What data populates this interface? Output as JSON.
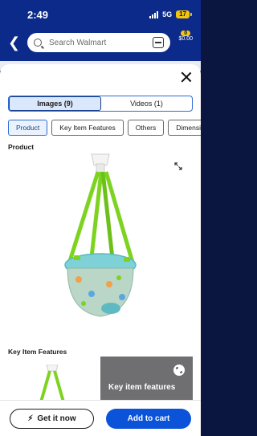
{
  "status": {
    "time": "2:49",
    "network": "5G",
    "battery": "17"
  },
  "background_header": {
    "search_placeholder": "Search Walmart",
    "cart_count": "0",
    "cart_total": "$0.00",
    "strip_text": "--"
  },
  "modal": {
    "media_tabs": [
      {
        "label": "Images (9)",
        "active": true
      },
      {
        "label": "Videos (1)",
        "active": false
      }
    ],
    "category_chips": [
      {
        "label": "Product",
        "active": true
      },
      {
        "label": "Key Item Features",
        "active": false
      },
      {
        "label": "Others",
        "active": false
      },
      {
        "label": "Dimensi",
        "active": false
      }
    ],
    "sections": {
      "product_heading": "Product",
      "features_heading": "Key Item Features",
      "feature_card_label": "Key item features"
    }
  },
  "actions": {
    "get_it_now": "Get it now",
    "add_to_cart": "Add to cart"
  },
  "colors": {
    "brand_blue": "#0b53d8",
    "header_blue": "#0b2a8a",
    "accent_yellow": "#f5c518",
    "harness_green": "#7ed321",
    "seat_teal": "#7fd1d8"
  },
  "icons": [
    "back-arrow-icon",
    "search-icon",
    "scan-icon",
    "cart-icon",
    "close-icon",
    "expand-icon",
    "lightning-icon"
  ]
}
